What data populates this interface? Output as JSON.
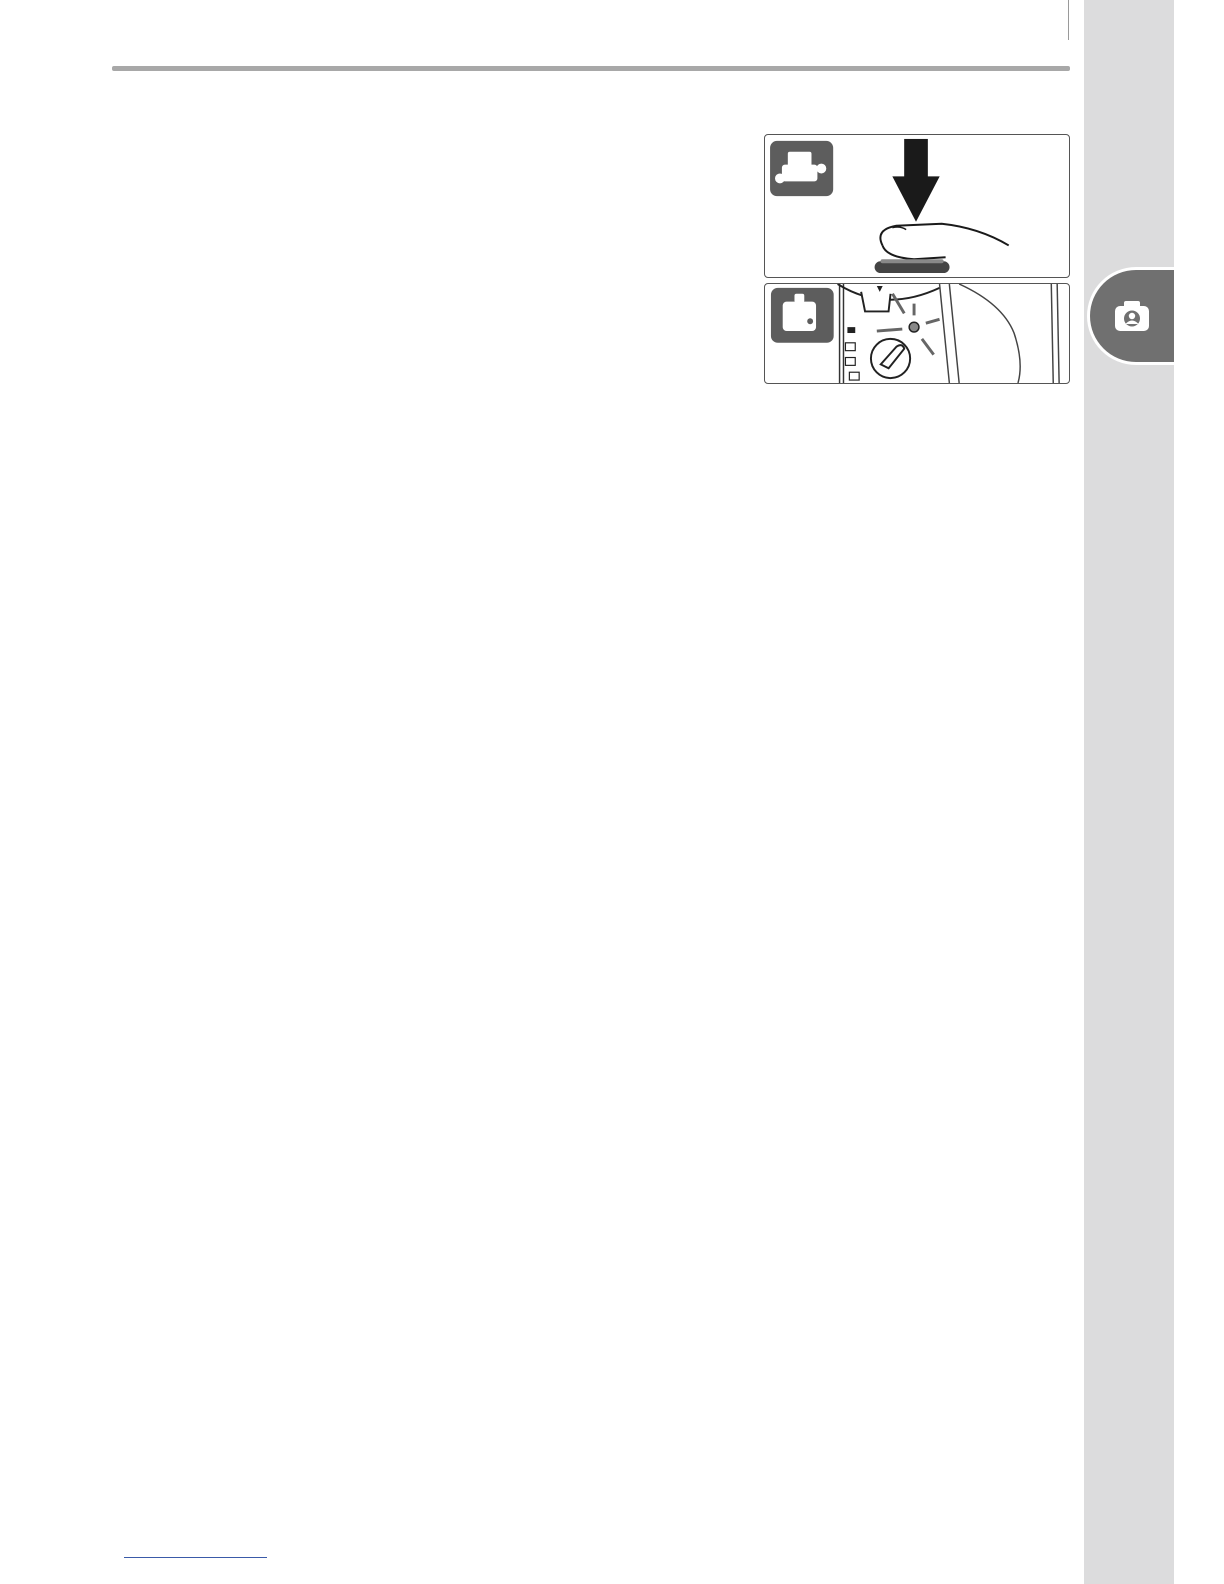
{
  "page": {
    "section_tab_icon": "camera-icon",
    "illustrations": [
      {
        "name": "shutter-press-illustration",
        "mode_icon": "camera-top-view-icon",
        "depicts": [
          "down-arrow-icon",
          "finger-icon",
          "shutter-release-button"
        ]
      },
      {
        "name": "focus-indicator-illustration",
        "mode_icon": "camera-back-view-icon",
        "depicts": [
          "mode-dial",
          "focus-indicator-lamp",
          "focus-mode-selector"
        ]
      }
    ],
    "colors": {
      "side_strip": "#dcdcdd",
      "side_tab": "#707070",
      "top_rule": "#a8a8a8",
      "footnote_rule": "#3a5aa8"
    }
  }
}
